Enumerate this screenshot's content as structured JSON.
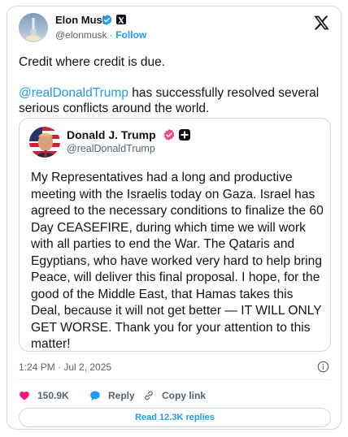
{
  "author": {
    "name": "Elon Musk",
    "handle": "@elonmusk",
    "separator": "·",
    "follow_label": "Follow"
  },
  "tweet": {
    "line1": "Credit where credit is due.",
    "mention": "@realDonaldTrump",
    "line2_rest": " has successfully resolved several serious conflicts around the world."
  },
  "quote": {
    "name": "Donald J. Trump",
    "handle": "@realDonaldTrump",
    "text": "My Representatives had a long and productive meeting with the Israelis today on Gaza. Israel has agreed to the necessary conditions to finalize the 60 Day CEASEFIRE, during which time we will work with all parties to end the War. The Qataris and Egyptians, who have worked very hard to help bring Peace, will deliver this final proposal. I hope, for the good of the Middle East, that Hamas takes this Deal, because it will not get better — IT WILL ONLY GET WORSE. Thank you for your attention to this matter!"
  },
  "meta": {
    "timestamp": "1:24 PM · Jul 2, 2025"
  },
  "actions": {
    "like_count": "150.9K",
    "reply_label": "Reply",
    "copy_label": "Copy link",
    "read_replies": "Read 12.3K replies"
  },
  "colors": {
    "accent": "#1d9bf0",
    "like": "#f91880",
    "text": "#0f1419",
    "muted": "#536471",
    "border": "#cfd9de",
    "trump_badge": "#f4467a"
  },
  "icons": [
    "verified-badge-icon",
    "x-affiliate-icon",
    "x-logo-icon",
    "info-icon",
    "heart-icon",
    "reply-bubble-icon",
    "link-icon",
    "plus-badge-icon"
  ]
}
